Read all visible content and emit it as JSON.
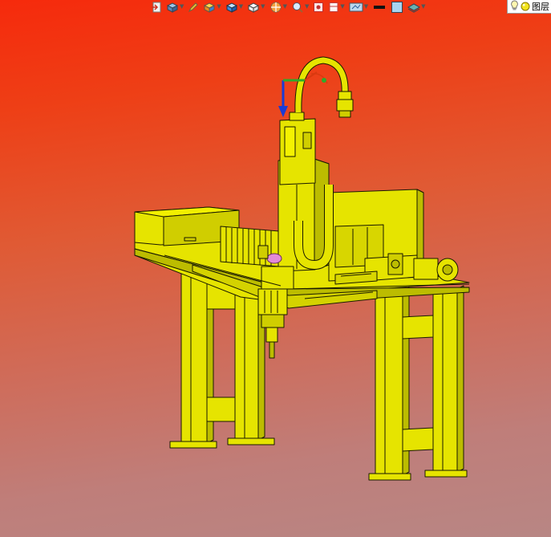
{
  "viewport": {
    "background_top": "#f62a0c",
    "background_bottom": "#b88684"
  },
  "toolbar": {
    "items": [
      {
        "name": "exit-sketch-icon",
        "has_menu": false
      },
      {
        "name": "view-orientation-icon",
        "has_menu": true
      },
      {
        "name": "pen-tool-icon",
        "has_menu": false
      },
      {
        "name": "materials-icon",
        "has_menu": true
      },
      {
        "name": "box-shaded-icon",
        "has_menu": true
      },
      {
        "name": "box-wireframe-icon",
        "has_menu": true
      },
      {
        "name": "section-view-icon",
        "has_menu": true
      },
      {
        "name": "zoom-area-icon",
        "has_menu": true
      },
      {
        "name": "capture-icon",
        "has_menu": false
      },
      {
        "name": "panel-layout-icon",
        "has_menu": true
      },
      {
        "name": "display-style-icon",
        "has_menu": true
      },
      {
        "name": "line-color-icon",
        "has_menu": false
      },
      {
        "name": "fill-color-icon",
        "has_menu": false
      },
      {
        "name": "layers-icon",
        "has_menu": true
      }
    ]
  },
  "status": {
    "bulb_icon": "lightbulb-icon",
    "sphere_icon": "yellow-sphere-icon",
    "label": "图层"
  },
  "model": {
    "body_color": "#e6e400",
    "shade_color": "#bcbc00",
    "edge_color": "#1a1a00",
    "axis_colors": {
      "z": "#1a3bd6",
      "x": "#d93a10",
      "y": "#2faa2a"
    }
  }
}
